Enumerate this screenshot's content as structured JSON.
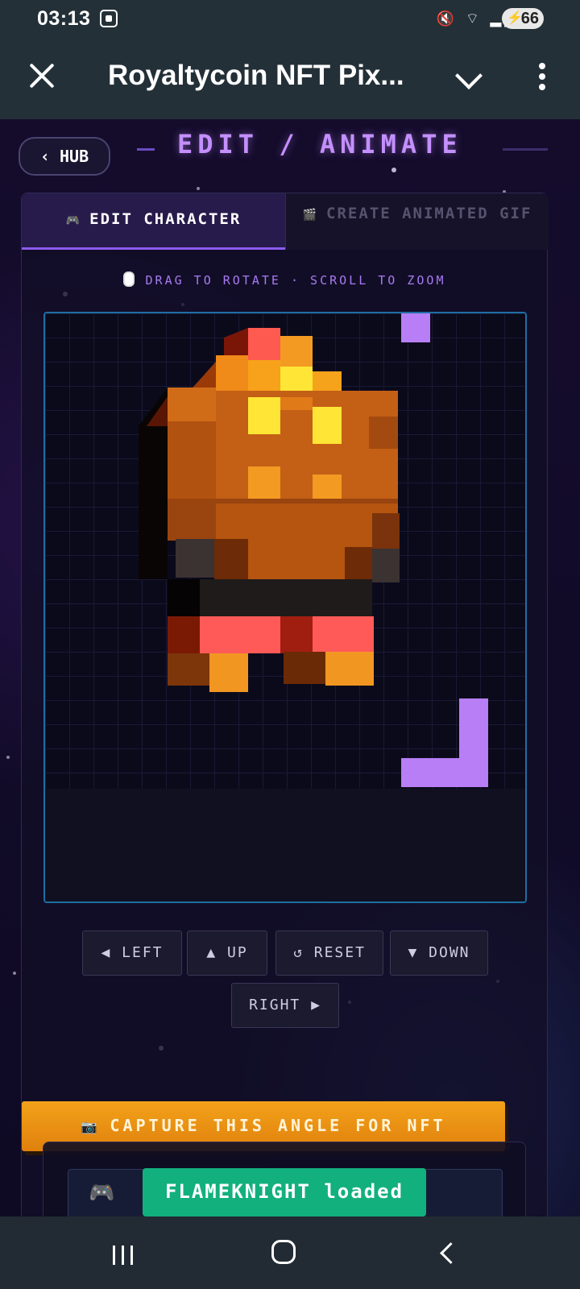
{
  "status": {
    "time": "03:13",
    "battery": "66"
  },
  "app": {
    "title": "Royaltycoin NFT Pix..."
  },
  "header": {
    "hub_label": "HUB",
    "title": "EDIT / ANIMATE"
  },
  "tabs": [
    {
      "label": "EDIT CHARACTER",
      "icon": "gamepad-icon",
      "active": true
    },
    {
      "label": "CREATE ANIMATED GIF",
      "icon": "clapper-icon",
      "active": false
    }
  ],
  "viewer": {
    "hint": "DRAG TO ROTATE · SCROLL TO ZOOM"
  },
  "controls": {
    "left": "◀ LEFT",
    "up": "▲ UP",
    "reset": "↺ RESET",
    "down": "▼ DOWN",
    "right": "RIGHT ▶"
  },
  "capture": {
    "label": "CAPTURE THIS ANGLE FOR NFT",
    "icon": "camera-icon"
  },
  "toast": {
    "message": "FLAMEKNIGHT loaded"
  },
  "colors": {
    "accent": "#c48fff",
    "capture": "#f0960f",
    "toast": "#12b07c",
    "viewport_border": "#1e6ea4"
  }
}
